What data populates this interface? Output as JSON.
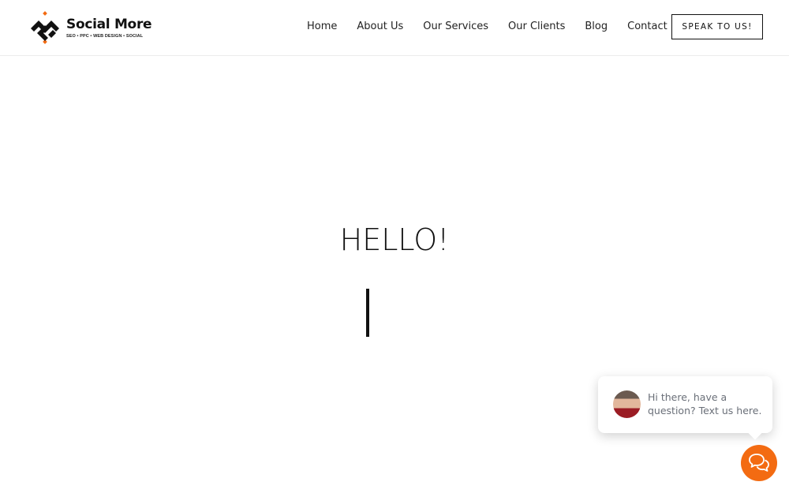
{
  "brand": {
    "name": "Social More",
    "tagline": "SEO • PPC • WEB DESIGN • SOCIAL",
    "accent": "#f36b12"
  },
  "nav": {
    "items": [
      "Home",
      "About Us",
      "Our Services",
      "Our Clients",
      "Blog",
      "Contact"
    ],
    "cta": "SPEAK TO US!"
  },
  "hero": {
    "heading": "HELLO!"
  },
  "chat": {
    "message": "Hi there, have a question? Text us here.",
    "button_color": "#f36b12",
    "icon": "chat-bubbles-icon"
  }
}
